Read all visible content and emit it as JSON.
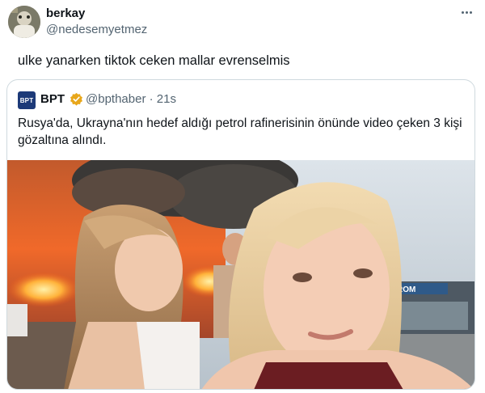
{
  "tweet": {
    "author_name": "berkay",
    "author_handle": "@nedesemyetmez",
    "text": "ulke yanarken tiktok ceken mallar evrenselmis",
    "more_icon": "more-horizontal-icon"
  },
  "quoted": {
    "avatar_text": "BPT",
    "name": "BPT",
    "verified_icon": "verified-gold-badge-icon",
    "handle_time": "@bpthaber · 21s",
    "text": "Rusya'da, Ukrayna'nın hedef aldığı petrol rafinerisinin önünde video çeken 3 kişi gözaltına alındı.",
    "sign_text": "ROM",
    "colors": {
      "fire": "#f0692a",
      "smoke": "#3a3836",
      "sky": "#c9d2d8",
      "badge": "#e8a71b"
    }
  }
}
